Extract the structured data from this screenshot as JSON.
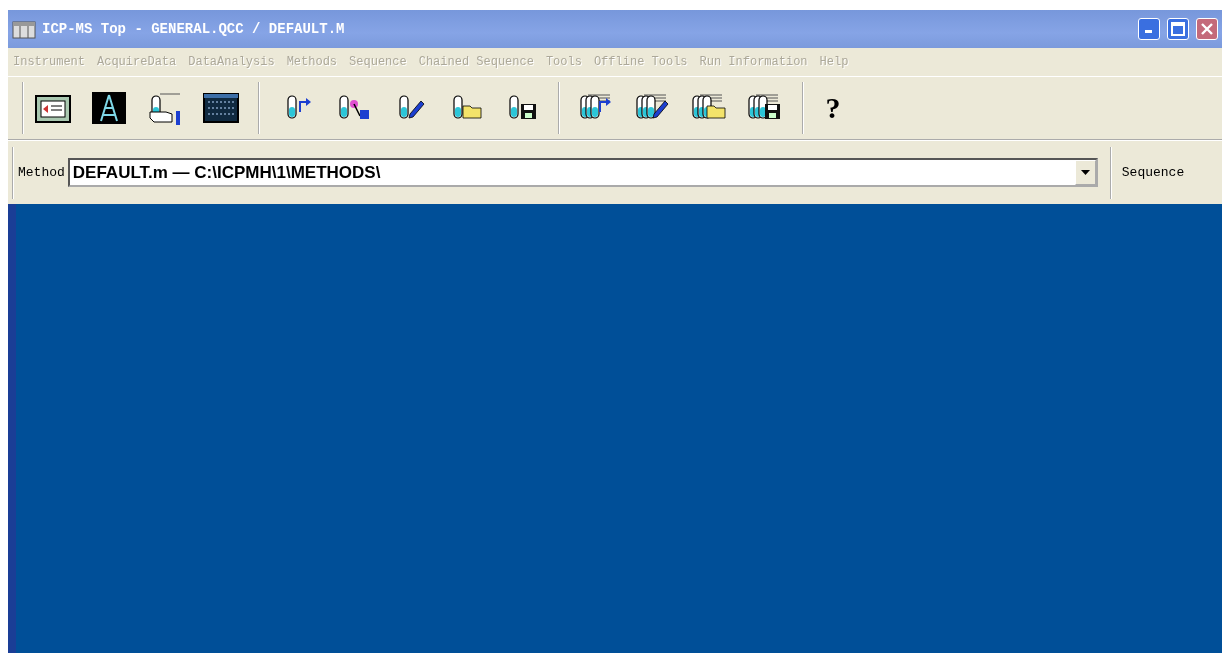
{
  "window": {
    "title": "ICP-MS Top - GENERAL.QCC / DEFAULT.M"
  },
  "menu": [
    {
      "label": "Instrument",
      "disabled": true
    },
    {
      "label": "AcquireData",
      "disabled": true
    },
    {
      "label": "DataAnalysis",
      "disabled": true
    },
    {
      "label": "Methods",
      "disabled": true
    },
    {
      "label": "Sequence",
      "disabled": true
    },
    {
      "label": "Chained Sequence",
      "disabled": true
    },
    {
      "label": "Tools",
      "disabled": true
    },
    {
      "label": "Offline Tools",
      "disabled": true
    },
    {
      "label": "Run Information",
      "disabled": true
    },
    {
      "label": "Help",
      "disabled": true
    }
  ],
  "toolbar": {
    "groups": [
      {
        "buttons": [
          {
            "kind": "panel"
          },
          {
            "kind": "tower"
          },
          {
            "kind": "hand-tube"
          },
          {
            "kind": "screen"
          }
        ]
      },
      {
        "buttons": [
          {
            "kind": "tube-arrow"
          },
          {
            "kind": "tube-wand"
          },
          {
            "kind": "tube-pencil"
          },
          {
            "kind": "tube-folder"
          },
          {
            "kind": "tube-disk"
          }
        ]
      },
      {
        "buttons": [
          {
            "kind": "rack-arrow"
          },
          {
            "kind": "rack-pencil"
          },
          {
            "kind": "rack-folder"
          },
          {
            "kind": "rack-disk"
          }
        ]
      },
      {
        "buttons": [
          {
            "kind": "help",
            "label": "?"
          }
        ]
      }
    ]
  },
  "method_bar": {
    "label": "Method",
    "value": "DEFAULT.m — C:\\ICPMH\\1\\METHODS\\",
    "next_label": "Sequence"
  }
}
